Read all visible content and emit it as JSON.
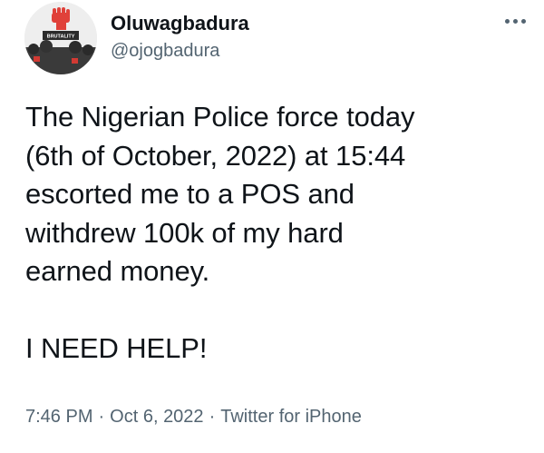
{
  "author": {
    "display_name": "Oluwagbadura",
    "handle": "@ojogbadura",
    "avatar": {
      "icon": "raised-fist-protest-avatar",
      "sign_text": "BRUTALITY"
    }
  },
  "more_icon": "more-horizontal-icon",
  "tweet": {
    "text": "The Nigerian Police force today\n(6th of October, 2022) at 15:44\nescorted me to a POS and\nwithdrew 100k of my hard\nearned money.\n\nI NEED HELP!"
  },
  "meta": {
    "time": "7:46 PM",
    "separator": "·",
    "date": "Oct 6, 2022",
    "source": "Twitter for iPhone"
  },
  "colors": {
    "text": "#0f1419",
    "secondary": "#536471",
    "fist_red": "#e0413a"
  }
}
